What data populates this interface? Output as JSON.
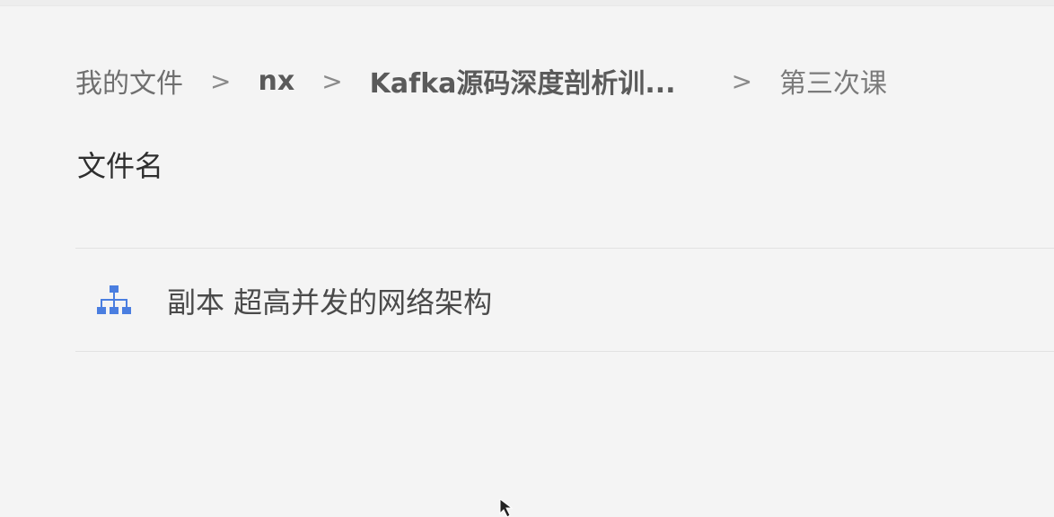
{
  "breadcrumb": {
    "items": [
      "我的文件",
      "nx",
      "Kafka源码深度剖析训...",
      "第三次课"
    ],
    "separator": ">"
  },
  "table": {
    "column_header": "文件名",
    "rows": [
      {
        "name": "副本 超高并发的网络架构",
        "icon": "mindmap-tree-icon"
      }
    ]
  },
  "colors": {
    "icon_blue": "#4a7ee0",
    "background": "#f4f4f4"
  }
}
